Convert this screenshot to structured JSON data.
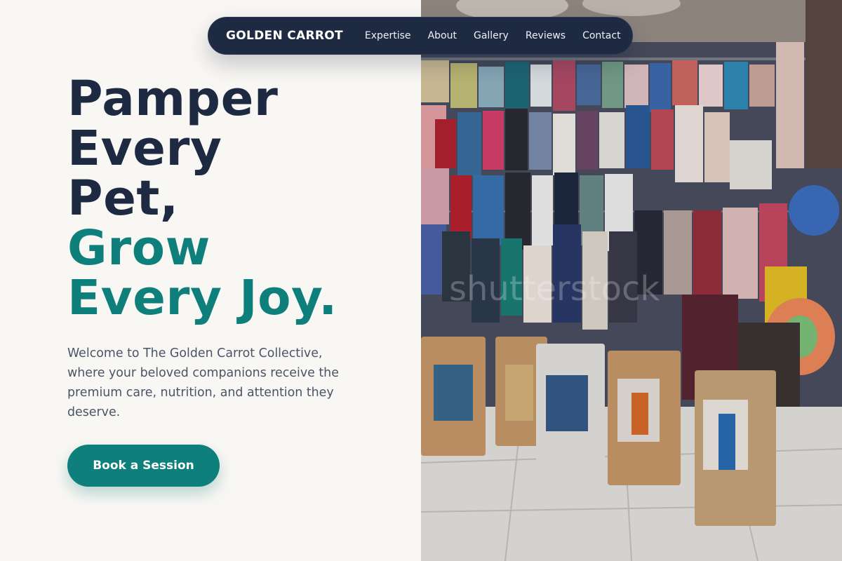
{
  "nav": {
    "brand": "GOLDEN CARROT",
    "links": [
      "Expertise",
      "About",
      "Gallery",
      "Reviews",
      "Contact"
    ]
  },
  "hero": {
    "headline_lines": [
      "Pamper",
      "Every",
      "Pet,",
      "Grow",
      "Every Joy."
    ],
    "intro": "Welcome to The Golden Carrot Collective, where your beloved companions receive the premium care, nutrition, and attention they deserve.",
    "cta_label": "Book a Session",
    "photo_watermark": "shutterstock"
  },
  "colors": {
    "background": "#f9f7f4",
    "navy": "#1e2a42",
    "teal": "#0e7f7b",
    "body_text": "#4a5468"
  }
}
